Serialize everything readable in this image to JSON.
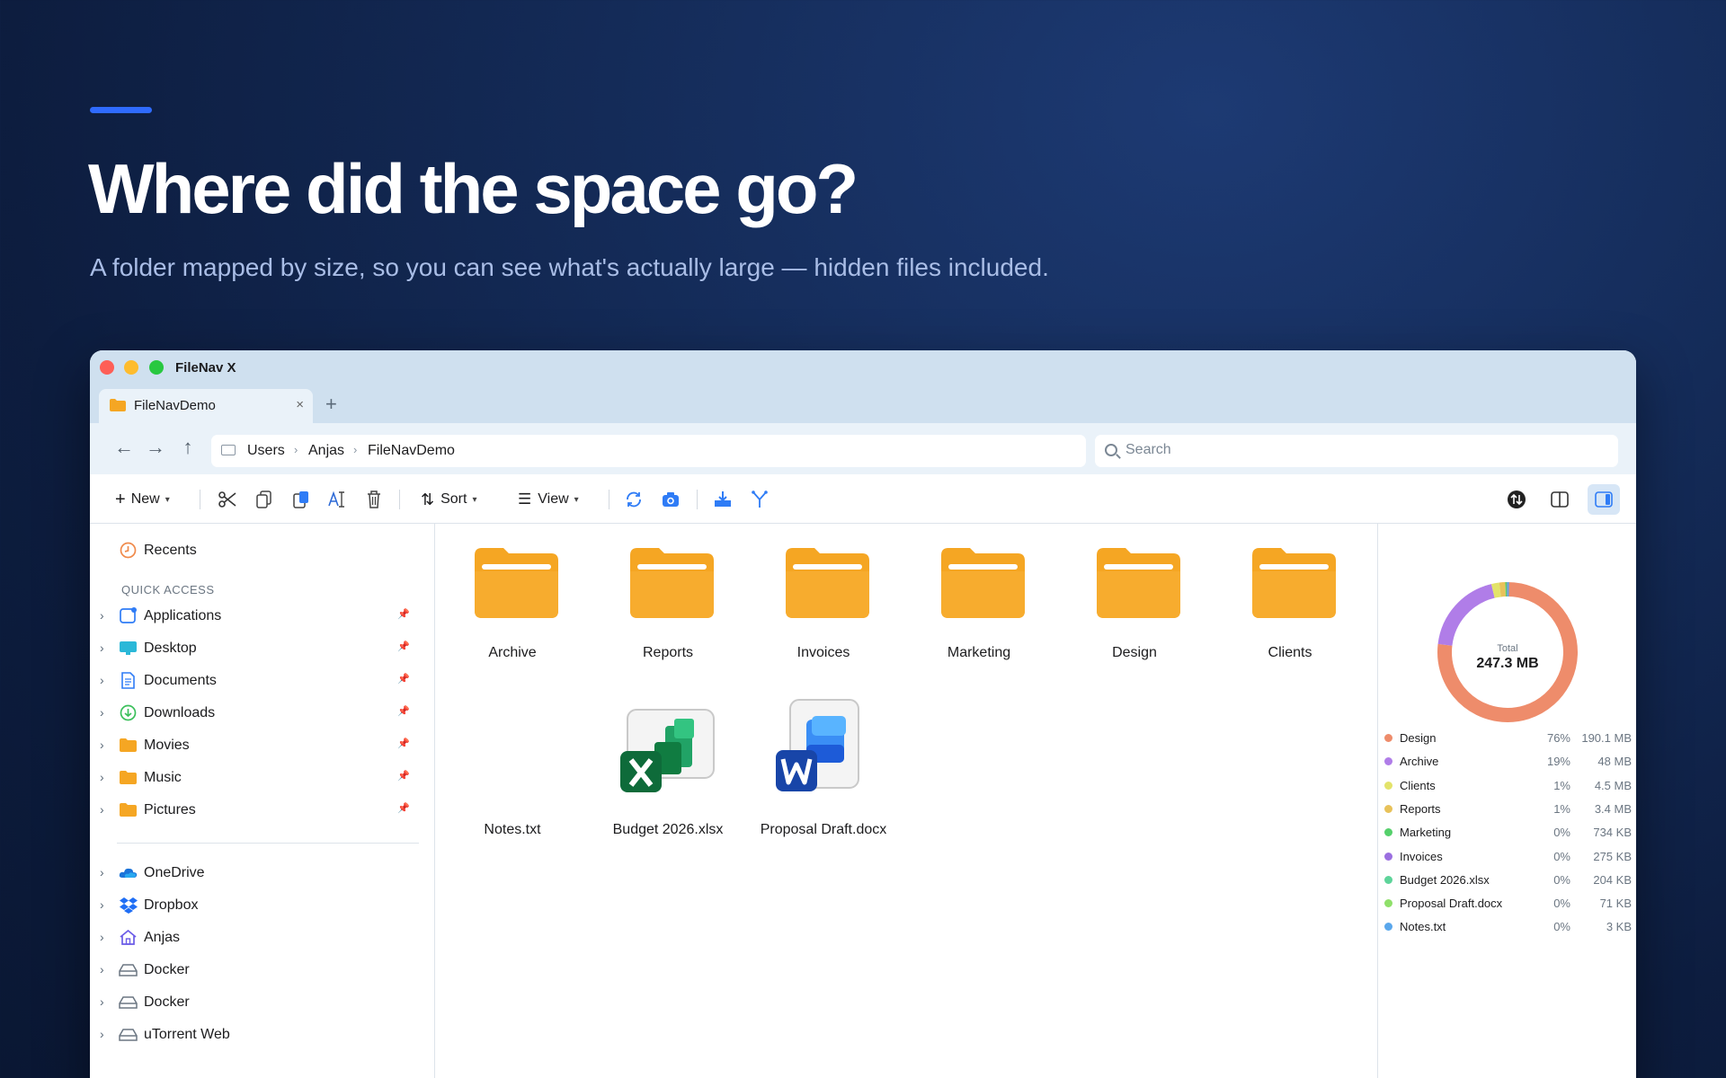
{
  "hero": {
    "title": "Where did the space go?",
    "subtitle": "A folder mapped by size, so you can see what's actually large — hidden files included."
  },
  "window": {
    "app_title": "FileNav X",
    "tab_label": "FileNavDemo",
    "tab_close": "×",
    "tab_add": "+"
  },
  "nav": {
    "back": "←",
    "forward": "→",
    "up": "↑",
    "breadcrumb": [
      "Users",
      "Anjas",
      "FileNavDemo"
    ],
    "breadcrumb_sep": "›",
    "search_placeholder": "Search"
  },
  "toolbar": {
    "new_label": "New",
    "sort_label": "Sort",
    "view_label": "View"
  },
  "sidebar": {
    "recents": "Recents",
    "section_title": "QUICK ACCESS",
    "quick_access": [
      {
        "label": "Applications",
        "icon": "applications-icon"
      },
      {
        "label": "Desktop",
        "icon": "desktop-icon"
      },
      {
        "label": "Documents",
        "icon": "documents-icon"
      },
      {
        "label": "Downloads",
        "icon": "downloads-icon"
      },
      {
        "label": "Movies",
        "icon": "folder-icon"
      },
      {
        "label": "Music",
        "icon": "folder-icon"
      },
      {
        "label": "Pictures",
        "icon": "folder-icon"
      }
    ],
    "locations": [
      {
        "label": "OneDrive",
        "icon": "onedrive-icon"
      },
      {
        "label": "Dropbox",
        "icon": "dropbox-icon"
      },
      {
        "label": "Anjas",
        "icon": "home-icon"
      },
      {
        "label": "Docker",
        "icon": "drive-icon"
      },
      {
        "label": "Docker",
        "icon": "drive-icon"
      },
      {
        "label": "uTorrent Web",
        "icon": "drive-icon"
      }
    ]
  },
  "files": {
    "folders": [
      "Archive",
      "Reports",
      "Invoices",
      "Marketing",
      "Design",
      "Clients"
    ],
    "documents": [
      {
        "name": "Notes.txt",
        "icon": "text-file-icon"
      },
      {
        "name": "Budget 2026.xlsx",
        "icon": "excel-icon"
      },
      {
        "name": "Proposal Draft.docx",
        "icon": "word-icon"
      }
    ]
  },
  "colors": {
    "accent": "#2f6bff",
    "folder": "#f5a623",
    "panel_bg": "#eaf2f9"
  },
  "chart_data": {
    "type": "pie",
    "center_label": "Total",
    "center_value": "247.3 MB",
    "slices": [
      {
        "name": "Design",
        "pct": "76%",
        "size": "190.1 MB",
        "mb": 190.1,
        "color": "#ee8c6b"
      },
      {
        "name": "Archive",
        "pct": "19%",
        "size": "48 MB",
        "mb": 48,
        "color": "#b07de8"
      },
      {
        "name": "Clients",
        "pct": "1%",
        "size": "4.5 MB",
        "mb": 4.5,
        "color": "#e3e36a"
      },
      {
        "name": "Reports",
        "pct": "1%",
        "size": "3.4 MB",
        "mb": 3.4,
        "color": "#e8c25a"
      },
      {
        "name": "Marketing",
        "pct": "0%",
        "size": "734 KB",
        "mb": 0.734,
        "color": "#55d06b"
      },
      {
        "name": "Invoices",
        "pct": "0%",
        "size": "275 KB",
        "mb": 0.275,
        "color": "#9b6fe0"
      },
      {
        "name": "Budget 2026.xlsx",
        "pct": "0%",
        "size": "204 KB",
        "mb": 0.204,
        "color": "#5ed49a"
      },
      {
        "name": "Proposal Draft.docx",
        "pct": "0%",
        "size": "71 KB",
        "mb": 0.071,
        "color": "#8fe06a"
      },
      {
        "name": "Notes.txt",
        "pct": "0%",
        "size": "3 KB",
        "mb": 0.003,
        "color": "#5aa7ec"
      }
    ]
  }
}
